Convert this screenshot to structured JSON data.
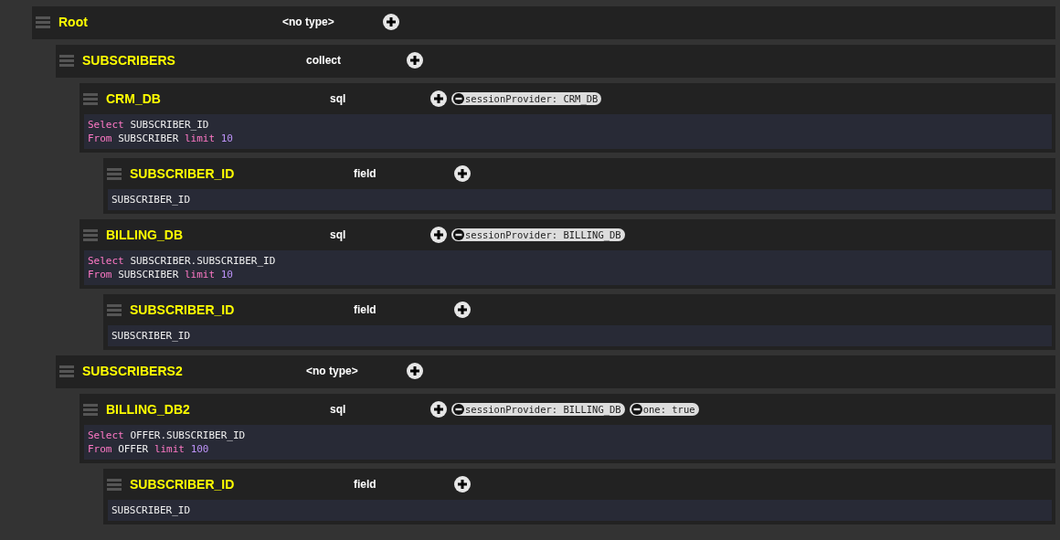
{
  "tree": [
    {
      "name": "Root",
      "type": "<no type>",
      "children": [
        {
          "name": "SUBSCRIBERS",
          "type": "collect",
          "children": [
            {
              "name": "CRM_DB",
              "type": "sql",
              "props": [
                "sessionProvider: CRM_DB"
              ],
              "code": [
                [
                  {
                    "kind": "keyword",
                    "text": "Select"
                  },
                  {
                    "kind": "plain",
                    "text": "SUBSCRIBER_ID"
                  }
                ],
                [
                  {
                    "kind": "keyword",
                    "text": "From"
                  },
                  {
                    "kind": "plain",
                    "text": "SUBSCRIBER"
                  },
                  {
                    "kind": "keyword",
                    "text": "limit"
                  },
                  {
                    "kind": "number",
                    "text": "10"
                  }
                ]
              ],
              "children": [
                {
                  "name": "SUBSCRIBER_ID",
                  "type": "field",
                  "code": [
                    [
                      {
                        "kind": "plain",
                        "text": "SUBSCRIBER_ID"
                      }
                    ]
                  ]
                }
              ]
            },
            {
              "name": "BILLING_DB",
              "type": "sql",
              "props": [
                "sessionProvider: BILLING_DB"
              ],
              "code": [
                [
                  {
                    "kind": "keyword",
                    "text": "Select"
                  },
                  {
                    "kind": "plain",
                    "text": "SUBSCRIBER.SUBSCRIBER_ID"
                  }
                ],
                [
                  {
                    "kind": "keyword",
                    "text": "From"
                  },
                  {
                    "kind": "plain",
                    "text": "SUBSCRIBER"
                  },
                  {
                    "kind": "keyword",
                    "text": "limit"
                  },
                  {
                    "kind": "number",
                    "text": "10"
                  }
                ]
              ],
              "children": [
                {
                  "name": "SUBSCRIBER_ID",
                  "type": "field",
                  "code": [
                    [
                      {
                        "kind": "plain",
                        "text": "SUBSCRIBER_ID"
                      }
                    ]
                  ]
                }
              ]
            }
          ]
        },
        {
          "name": "SUBSCRIBERS2",
          "type": "<no type>",
          "children": [
            {
              "name": "BILLING_DB2",
              "type": "sql",
              "props": [
                "sessionProvider: BILLING_DB",
                "one: true"
              ],
              "code": [
                [
                  {
                    "kind": "keyword",
                    "text": "Select"
                  },
                  {
                    "kind": "plain",
                    "text": "OFFER.SUBSCRIBER_ID"
                  }
                ],
                [
                  {
                    "kind": "keyword",
                    "text": "From"
                  },
                  {
                    "kind": "plain",
                    "text": "OFFER"
                  },
                  {
                    "kind": "keyword",
                    "text": "limit"
                  },
                  {
                    "kind": "number",
                    "text": "100"
                  }
                ]
              ],
              "children": [
                {
                  "name": "SUBSCRIBER_ID",
                  "type": "field",
                  "code": [
                    [
                      {
                        "kind": "plain",
                        "text": "SUBSCRIBER_ID"
                      }
                    ]
                  ]
                }
              ]
            }
          ]
        }
      ]
    }
  ]
}
